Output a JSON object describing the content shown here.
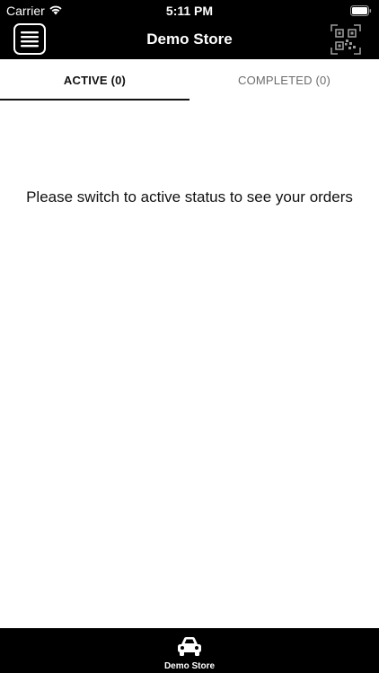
{
  "status_bar": {
    "carrier": "Carrier",
    "time": "5:11 PM",
    "icons": [
      "wifi-icon",
      "battery-icon"
    ]
  },
  "nav": {
    "title": "Demo Store",
    "left_icon": "hamburger-menu-icon",
    "right_icon": "qr-code-icon"
  },
  "tabs": [
    {
      "label": "ACTIVE (0)",
      "active": true
    },
    {
      "label": "COMPLETED (0)",
      "active": false
    }
  ],
  "main": {
    "empty_message": "Please switch to active status to see your orders"
  },
  "bottom_bar": {
    "label": "Demo Store",
    "icon": "car-icon"
  },
  "colors": {
    "bar_background": "#000000",
    "text_primary": "#111111",
    "text_inactive": "#6b6b6b",
    "background": "#ffffff"
  }
}
